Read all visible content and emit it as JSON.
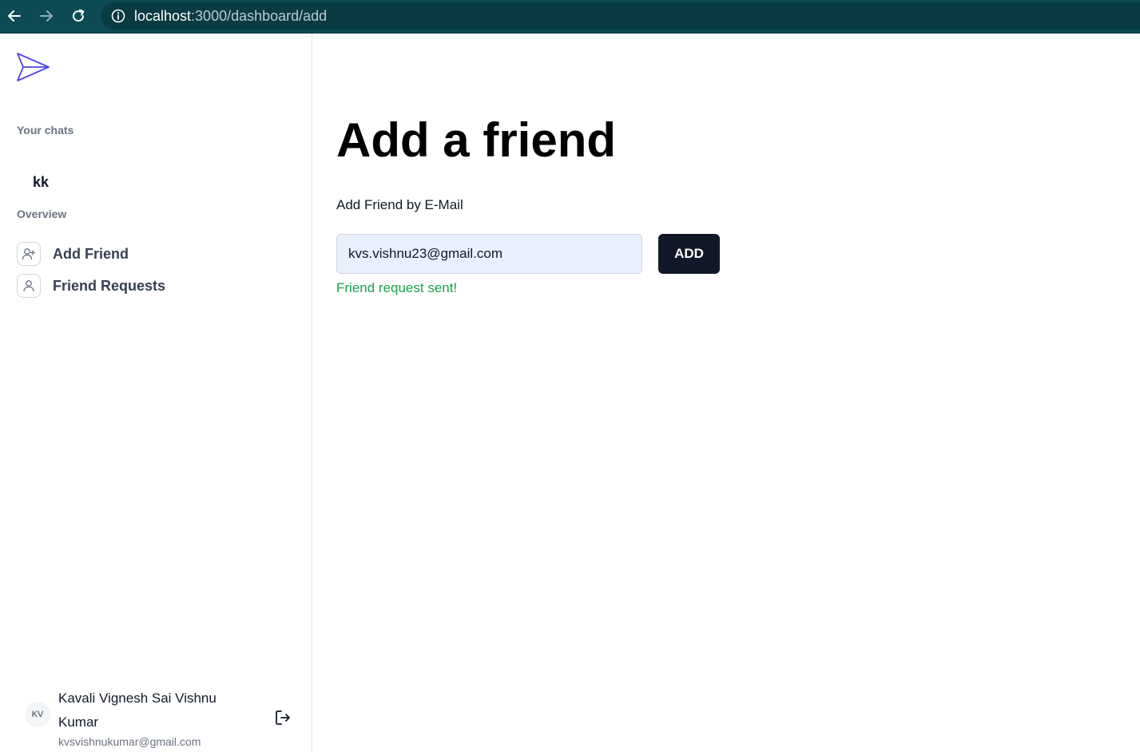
{
  "browser": {
    "url_host": "localhost",
    "url_path": ":3000/dashboard/add"
  },
  "sidebar": {
    "logo_icon": "paper-plane-icon",
    "your_chats_label": "Your chats",
    "chats": [
      {
        "label": "kk"
      }
    ],
    "overview_label": "Overview",
    "nav": [
      {
        "label": "Add Friend",
        "icon": "user-plus-icon"
      },
      {
        "label": "Friend Requests",
        "icon": "user-icon"
      }
    ],
    "profile": {
      "initials": "KV",
      "name": "Kavali Vignesh Sai Vishnu Kumar",
      "email": "kvsvishnukumar@gmail.com"
    }
  },
  "main": {
    "title": "Add a friend",
    "field_label": "Add Friend by E-Mail",
    "email_value": "kvs.vishnu23@gmail.com",
    "add_button_label": "ADD",
    "success_message": "Friend request sent!"
  },
  "colors": {
    "browser_bar": "#0e4a54",
    "accent_logo": "#4f46e5",
    "button_bg": "#111827",
    "success": "#16a34a",
    "input_bg": "#e8f0fe"
  }
}
